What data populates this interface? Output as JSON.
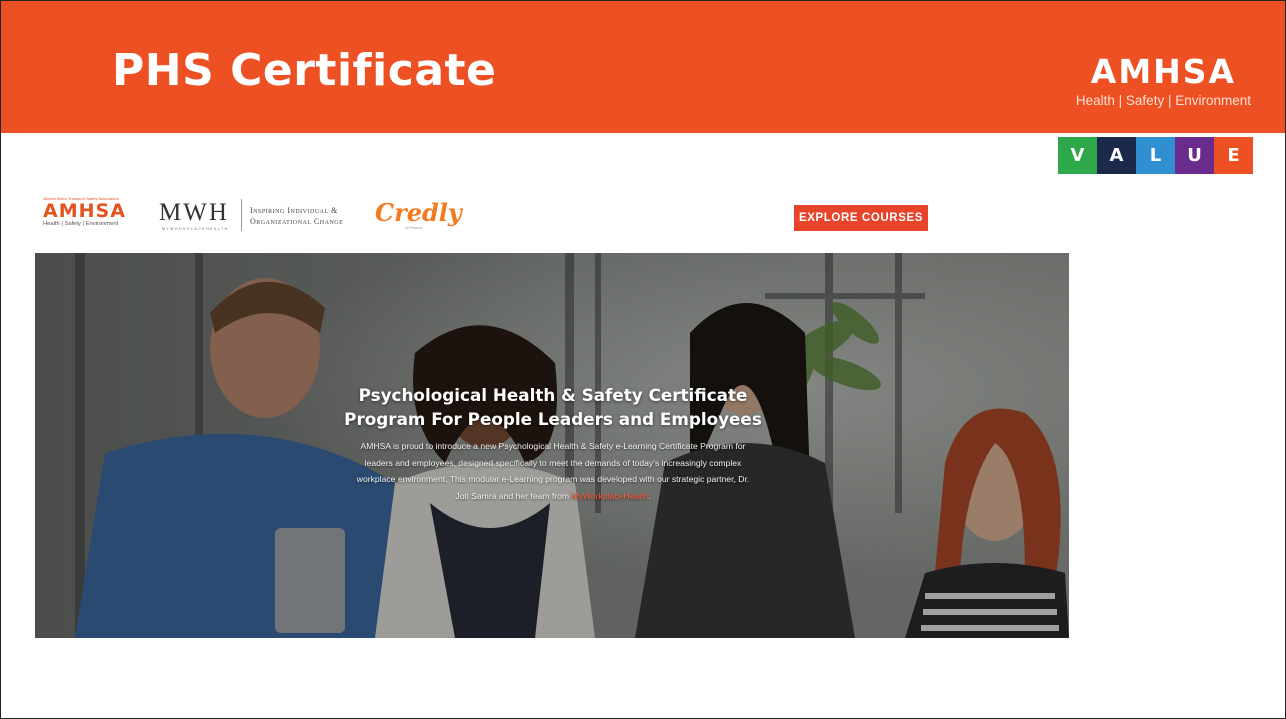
{
  "slide": {
    "title": "PHS Certificate",
    "brand_name": "AMHSA",
    "brand_tagline": "Health | Safety | Environment",
    "value_letters": [
      {
        "letter": "V",
        "color": "#2ea84a"
      },
      {
        "letter": "A",
        "color": "#1b2a4a"
      },
      {
        "letter": "L",
        "color": "#2f8fd0"
      },
      {
        "letter": "U",
        "color": "#6a2c8c"
      },
      {
        "letter": "E",
        "color": "#ec5023"
      }
    ]
  },
  "site": {
    "amhsa_logo": {
      "small_text": "Alberta Motor Transport Safety Association",
      "name": "AMHSA",
      "tagline": "Health | Safety | Environment"
    },
    "mwh_logo": {
      "name": "MWH",
      "small_text": "MYWORKPLACEHEALTH",
      "tagline_line1": "Inspiring Individual &",
      "tagline_line2": "Organizational Change"
    },
    "credly_logo": {
      "name": "Credly",
      "small_text": "by Pearson"
    },
    "explore_button": "EXPLORE COURSES",
    "hero": {
      "title_line1": "Psychological Health & Safety Certificate",
      "title_line2": "Program For People Leaders and Employees",
      "body_line1": "AMHSA is proud to introduce a new Psychological Health & Safety e-Learning Certificate Program for",
      "body_line2": "leaders and employees, designed specifically to meet the demands of today's increasingly complex",
      "body_line3": "workplace environment. This modular e-Learning program was developed with our strategic partner, Dr.",
      "body_line4_prefix": "Joti Samra and her team from ",
      "body_link": "MyWorkplaceHealth",
      "body_line4_suffix": "."
    }
  },
  "colors": {
    "title_bar": "#ec5023",
    "button": "#e8442b",
    "accent_link": "#ff5a3a"
  }
}
